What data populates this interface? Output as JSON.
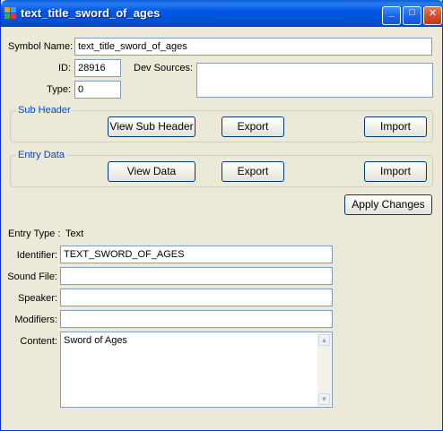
{
  "window": {
    "title": "text_title_sword_of_ages",
    "minimize_glyph": "_",
    "maximize_glyph": "□",
    "close_glyph": "✕"
  },
  "symbol": {
    "name_label": "Symbol Name:",
    "name_value": "text_title_sword_of_ages",
    "id_label": "ID:",
    "id_value": "28916",
    "type_label": "Type:",
    "type_value": "0",
    "dev_sources_label": "Dev Sources:",
    "dev_sources_value": ""
  },
  "sub_header": {
    "title": "Sub Header",
    "view_button": "View Sub Header",
    "export_button": "Export",
    "import_button": "Import"
  },
  "entry_data": {
    "title": "Entry Data",
    "view_button": "View Data",
    "export_button": "Export",
    "import_button": "Import"
  },
  "apply_button": "Apply Changes",
  "entry": {
    "type_label": "Entry Type :",
    "type_value": "Text",
    "identifier_label": "Identifier:",
    "identifier_value": "TEXT_SWORD_OF_AGES",
    "sound_file_label": "Sound File:",
    "sound_file_value": "",
    "speaker_label": "Speaker:",
    "speaker_value": "",
    "modifiers_label": "Modifiers:",
    "modifiers_value": "",
    "content_label": "Content:",
    "content_value": "Sword of Ages"
  },
  "icons": {
    "app": "app-icon",
    "scroll_up": "scroll-up-arrow-icon",
    "scroll_down": "scroll-down-arrow-icon"
  },
  "colors": {
    "titlebar": "#0058e6",
    "window_bg": "#ece9d8",
    "group_title": "#0046d5",
    "input_border": "#7f9db9"
  }
}
